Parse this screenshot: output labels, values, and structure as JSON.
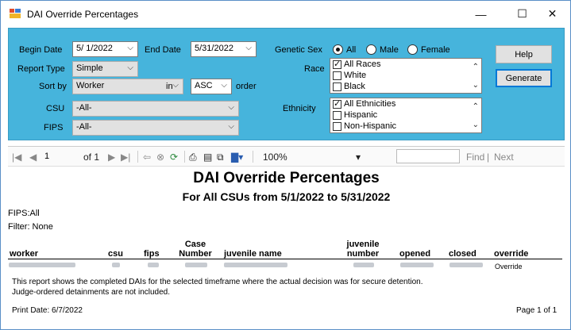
{
  "window": {
    "title": "DAI Override Percentages",
    "minimize_glyph": "—",
    "maximize_glyph": "☐",
    "close_glyph": "✕"
  },
  "filters": {
    "begin_date_label": "Begin Date",
    "begin_date_value": "5/ 1/2022",
    "end_date_label": "End Date",
    "end_date_value": "5/31/2022",
    "report_type_label": "Report Type",
    "report_type_value": "Simple",
    "sort_by_label": "Sort by",
    "sort_by_value": "Worker",
    "in_label": "in",
    "order_value": "ASC",
    "order_label": "order",
    "csu_label": "CSU",
    "csu_value": "-All-",
    "fips_label": "FIPS",
    "fips_value": "-All-",
    "genetic_sex_label": "Genetic Sex",
    "genetic_sex_options": [
      "All",
      "Male",
      "Female"
    ],
    "genetic_sex_selected": "All",
    "race_label": "Race",
    "race_items": [
      {
        "label": "All Races",
        "checked": true
      },
      {
        "label": "White",
        "checked": false
      },
      {
        "label": "Black",
        "checked": false
      }
    ],
    "ethnicity_label": "Ethnicity",
    "ethnicity_items": [
      {
        "label": "All Ethnicities",
        "checked": true
      },
      {
        "label": "Hispanic",
        "checked": false
      },
      {
        "label": "Non-Hispanic",
        "checked": false
      }
    ],
    "help_label": "Help",
    "generate_label": "Generate"
  },
  "toolbar": {
    "page_current": "1",
    "page_of": "of 1",
    "zoom": "100%",
    "find_label": "Find",
    "next_label": "Next"
  },
  "report": {
    "title": "DAI Override Percentages",
    "subtitle": "For All CSUs from 5/1/2022 to 5/31/2022",
    "fips_line": "FIPS:All",
    "filter_line": "Filter: None",
    "columns": [
      "worker",
      "csu",
      "fips",
      "Case Number",
      "juvenile name",
      "juvenile number",
      "opened",
      "closed",
      "override"
    ],
    "row_override": "Override",
    "note_line1": "This report shows the completed DAIs for the selected timeframe where the actual decision was for secure detention.",
    "note_line2": "Judge-ordered detainments are not included.",
    "print_date": "Print Date: 6/7/2022",
    "page_label": "Page 1 of 1"
  },
  "colors": {
    "panel": "#46b4dc",
    "accent": "#0078d7"
  }
}
